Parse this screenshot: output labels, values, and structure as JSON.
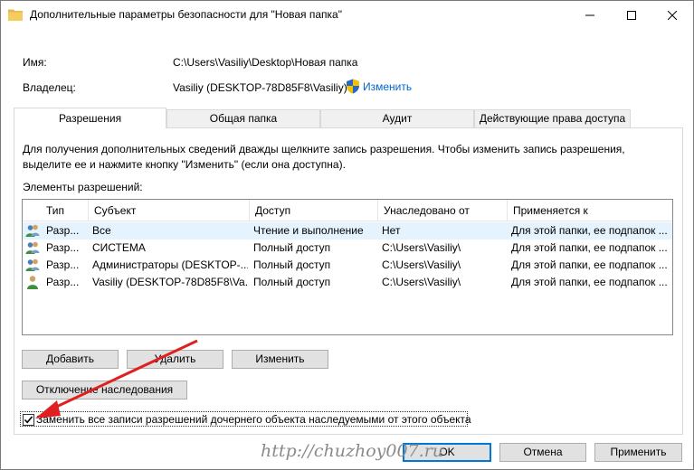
{
  "window": {
    "title": "Дополнительные параметры безопасности  для \"Новая папка\"",
    "controls": [
      "minimize",
      "maximize",
      "close"
    ]
  },
  "info": {
    "name_label": "Имя:",
    "name_value": "C:\\Users\\Vasiliy\\Desktop\\Новая папка",
    "owner_label": "Владелец:",
    "owner_value": "Vasiliy (DESKTOP-78D85F8\\Vasiliy)",
    "change_link": "Изменить"
  },
  "tabs": [
    {
      "label": "Разрешения",
      "active": true
    },
    {
      "label": "Общая папка",
      "active": false
    },
    {
      "label": "Аудит",
      "active": false
    },
    {
      "label": "Действующие права доступа",
      "active": false
    }
  ],
  "hint": "Для получения дополнительных сведений дважды щелкните запись разрешения. Чтобы изменить запись разрешения, выделите ее и нажмите кнопку \"Изменить\" (если она доступна).",
  "permissions": {
    "label": "Элементы разрешений:",
    "columns": [
      "Тип",
      "Субъект",
      "Доступ",
      "Унаследовано от",
      "Применяется к"
    ],
    "rows": [
      {
        "icon": "group-icon",
        "type": "Разр...",
        "subject": "Все",
        "access": "Чтение и выполнение",
        "inherited": "Нет",
        "applies": "Для этой папки, ее подпапок ..."
      },
      {
        "icon": "group-icon",
        "type": "Разр...",
        "subject": "СИСТЕМА",
        "access": "Полный доступ",
        "inherited": "C:\\Users\\Vasiliy\\",
        "applies": "Для этой папки, ее подпапок ..."
      },
      {
        "icon": "group-icon",
        "type": "Разр...",
        "subject": "Администраторы (DESKTOP-...",
        "access": "Полный доступ",
        "inherited": "C:\\Users\\Vasiliy\\",
        "applies": "Для этой папки, ее подпапок ..."
      },
      {
        "icon": "user-icon",
        "type": "Разр...",
        "subject": "Vasiliy (DESKTOP-78D85F8\\Va...",
        "access": "Полный доступ",
        "inherited": "C:\\Users\\Vasiliy\\",
        "applies": "Для этой папки, ее подпапок ..."
      }
    ]
  },
  "buttons": {
    "add": "Добавить",
    "remove": "Удалить",
    "edit": "Изменить",
    "disable_inheritance": "Отключение наследования",
    "ok": "OK",
    "cancel": "Отмена",
    "apply": "Применить"
  },
  "checkbox": {
    "label": "Заменить все записи разрешений дочернего объекта наследуемыми от этого объекта",
    "checked": true
  },
  "watermark": "http://chuzhoy007.ru",
  "colors": {
    "link": "#0066cc",
    "selected_row": "#e5f3ff",
    "arrow": "#e02020",
    "primary_border": "#0078d7"
  }
}
